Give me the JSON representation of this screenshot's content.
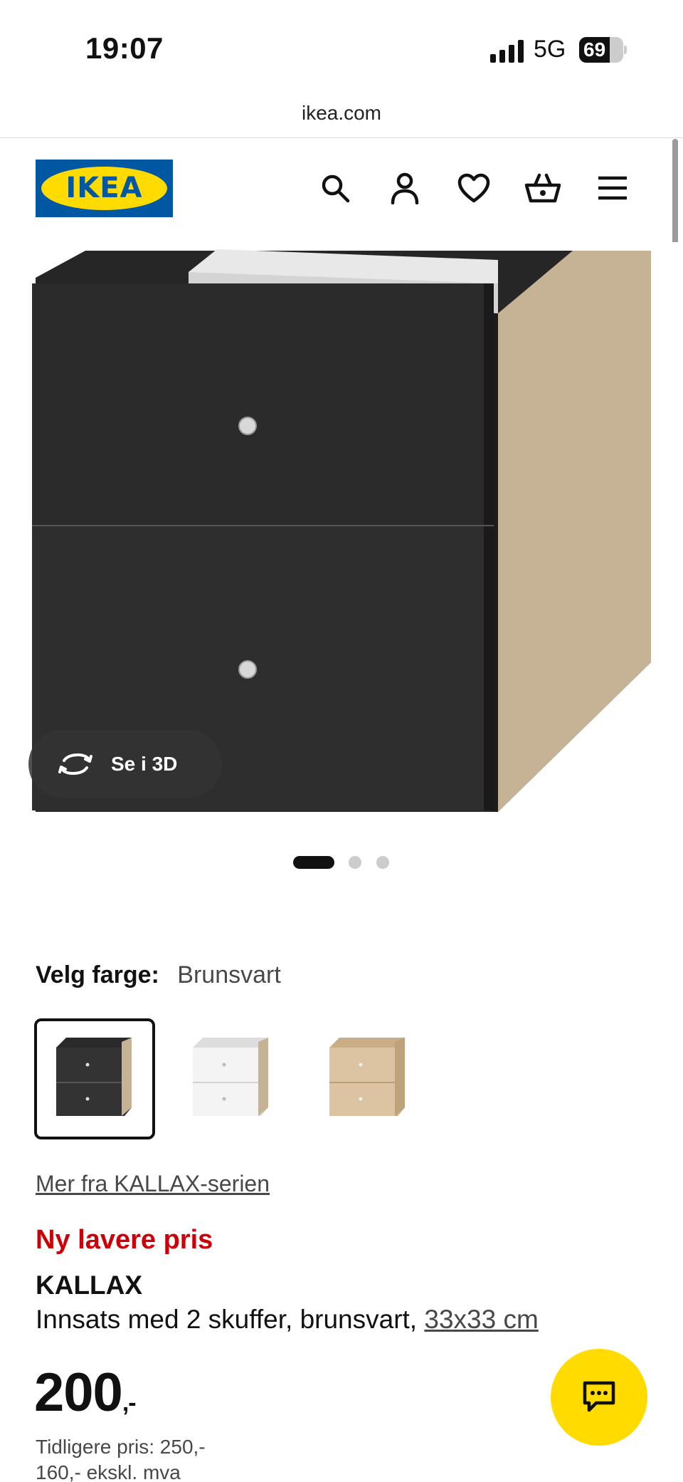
{
  "status_bar": {
    "time": "19:07",
    "network": "5G",
    "battery_percent": "69",
    "battery_level": 0.69
  },
  "browser": {
    "url": "ikea.com"
  },
  "header": {
    "logo_text": "IKEA",
    "icons": [
      "search-icon",
      "account-icon",
      "heart-icon",
      "basket-icon",
      "menu-icon"
    ]
  },
  "gallery": {
    "view_3d_label": "Se i 3D",
    "image_count": 3,
    "active_index": 0
  },
  "color_selector": {
    "label": "Velg farge:",
    "selected_value": "Brunsvart",
    "options": [
      {
        "name": "brunsvart",
        "selected": true
      },
      {
        "name": "hvit",
        "selected": false
      },
      {
        "name": "bjorkemonstret",
        "selected": false
      }
    ]
  },
  "series_link": "Mer fra KALLAX-serien",
  "product": {
    "badge": "Ny lavere pris",
    "name": "KALLAX",
    "description_prefix": "Innsats med 2 skuffer, brunsvart, ",
    "size_link": "33x33 cm",
    "price": "200",
    "price_suffix": ",-",
    "previous_price": "Tidligere pris: 250,-",
    "ex_vat": "160,- ekskl. mva"
  },
  "colors": {
    "brand_blue": "#0058a3",
    "brand_yellow": "#ffdb00",
    "sale_red": "#cc0008"
  }
}
